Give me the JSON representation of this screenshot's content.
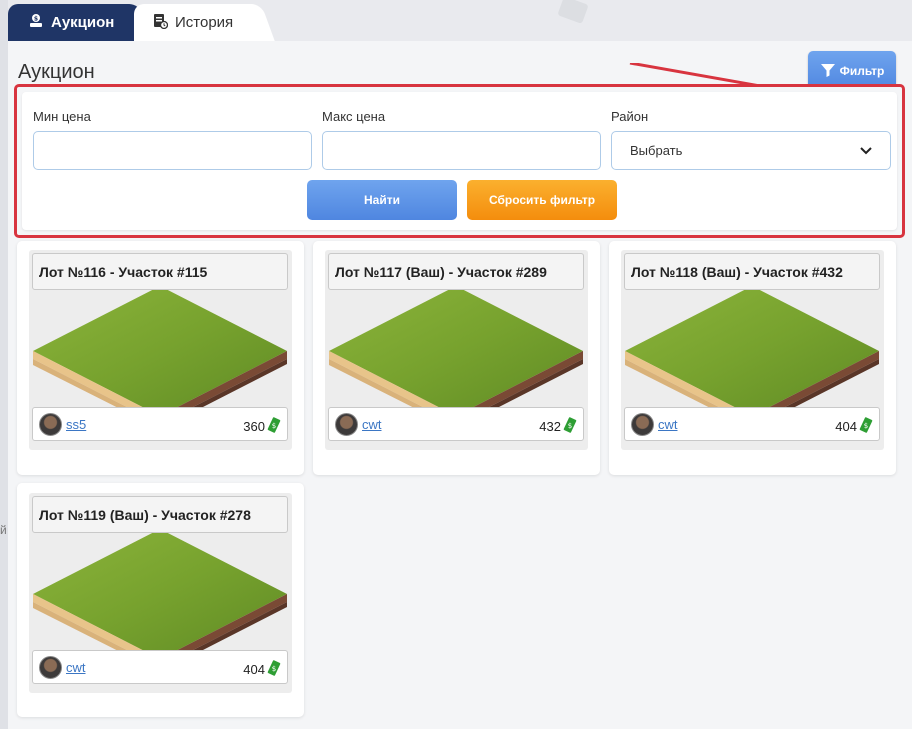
{
  "tabs": [
    {
      "label": "Аукцион",
      "active": true,
      "icon": "auction-icon"
    },
    {
      "label": "История",
      "active": false,
      "icon": "history-icon"
    }
  ],
  "page": {
    "title": "Аукцион"
  },
  "filter_button": {
    "label": "Фильтр",
    "icon": "funnel-icon"
  },
  "filter": {
    "min_price_label": "Мин цена",
    "min_price_value": "",
    "max_price_label": "Макс цена",
    "max_price_value": "",
    "district_label": "Район",
    "district_selected": "Выбрать",
    "find_label": "Найти",
    "reset_label": "Сбросить фильтр"
  },
  "colors": {
    "accent_blue": "#4f86e0",
    "accent_orange": "#f48d0d",
    "highlight_red": "#d8343f",
    "tab_navy": "#1f3566",
    "money_green": "#2e9e34"
  },
  "lots": [
    {
      "title": "Лот №116 - Участок #115",
      "seller": "ss5",
      "price": "360"
    },
    {
      "title": "Лот №117 (Ваш) - Участок #289",
      "seller": "cwt",
      "price": "432"
    },
    {
      "title": "Лот №118 (Ваш) - Участок #432",
      "seller": "cwt",
      "price": "404"
    },
    {
      "title": "Лот №119 (Ваш) - Участок #278",
      "seller": "cwt",
      "price": "404"
    }
  ]
}
